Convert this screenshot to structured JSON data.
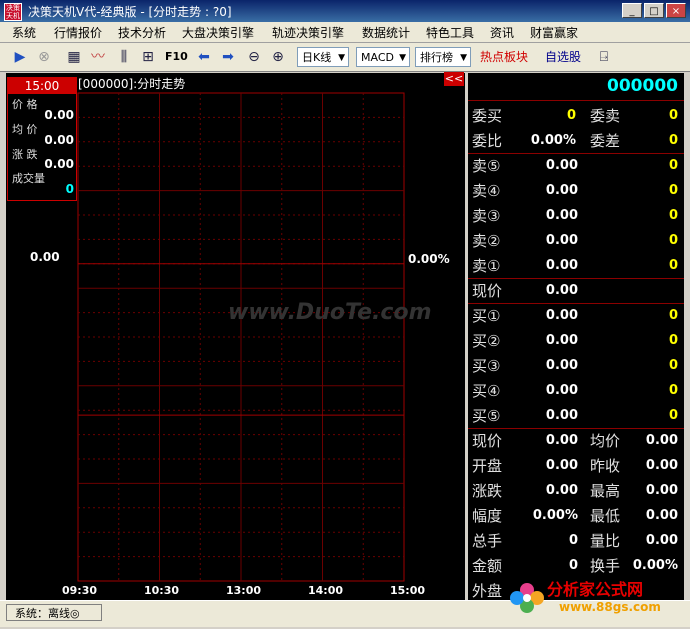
{
  "window": {
    "title": "决策天机V代-经典版 - [分时走势 : ?0]",
    "logo_text": "决策天机",
    "min_label": "_",
    "max_label": "□",
    "close_label": "×"
  },
  "menu": [
    "系统",
    "行情报价",
    "技术分析",
    "大盘决策引擎",
    "轨迹决策引擎",
    "数据统计",
    "特色工具",
    "资讯",
    "财富赢家"
  ],
  "toolbar": {
    "f10_label": "F10",
    "period_select": "日K线",
    "indicator_select": "MACD",
    "rank_select": "排行榜",
    "hot_label": "热点板块",
    "watchlist_label": "自选股"
  },
  "chart": {
    "title": "[000000]:分时走势",
    "collapse_label": "<<",
    "price_mid": "0.00",
    "pct_mid": "0.00%",
    "time_ticks": [
      "09:30",
      "10:30",
      "13:00",
      "14:00",
      "15:00"
    ],
    "watermark": "www.DuoTe.com"
  },
  "info_box": {
    "time": "15:00",
    "price_label": "价  格",
    "price_value": "0.00",
    "avg_label": "均  价",
    "avg_value": "0.00",
    "change_label": "涨  跌",
    "change_value": "0.00",
    "volume_label": "成交量",
    "volume_value": "0"
  },
  "quote": {
    "code": "000000",
    "weibuy_label": "委买",
    "weibuy_value": "0",
    "weisell_label": "委卖",
    "weisell_value": "0",
    "weibi_label": "委比",
    "weibi_value": "0.00%",
    "weicha_label": "委差",
    "weicha_value": "0",
    "sells": [
      {
        "label": "卖⑤",
        "price": "0.00",
        "vol": "0"
      },
      {
        "label": "卖④",
        "price": "0.00",
        "vol": "0"
      },
      {
        "label": "卖③",
        "price": "0.00",
        "vol": "0"
      },
      {
        "label": "卖②",
        "price": "0.00",
        "vol": "0"
      },
      {
        "label": "卖①",
        "price": "0.00",
        "vol": "0"
      }
    ],
    "current_label": "现价",
    "current_value": "0.00",
    "buys": [
      {
        "label": "买①",
        "price": "0.00",
        "vol": "0"
      },
      {
        "label": "买②",
        "price": "0.00",
        "vol": "0"
      },
      {
        "label": "买③",
        "price": "0.00",
        "vol": "0"
      },
      {
        "label": "买④",
        "price": "0.00",
        "vol": "0"
      },
      {
        "label": "买⑤",
        "price": "0.00",
        "vol": "0"
      }
    ],
    "stats": [
      {
        "l1": "现价",
        "v1": "0.00",
        "l2": "均价",
        "v2": "0.00"
      },
      {
        "l1": "开盘",
        "v1": "0.00",
        "l2": "昨收",
        "v2": "0.00"
      },
      {
        "l1": "涨跌",
        "v1": "0.00",
        "l2": "最高",
        "v2": "0.00"
      },
      {
        "l1": "幅度",
        "v1": "0.00%",
        "l2": "最低",
        "v2": "0.00"
      },
      {
        "l1": "总手",
        "v1": "0",
        "l2": "量比",
        "v2": "0.00"
      },
      {
        "l1": "金额",
        "v1": "0",
        "l2": "换手",
        "v2": "0.00%"
      },
      {
        "l1": "外盘",
        "v1": "",
        "l2": "",
        "v2": ""
      }
    ]
  },
  "status": {
    "text": "系统：离线◎",
    "brand": "分析家公式网",
    "brand_url": "www.88gs.com"
  }
}
